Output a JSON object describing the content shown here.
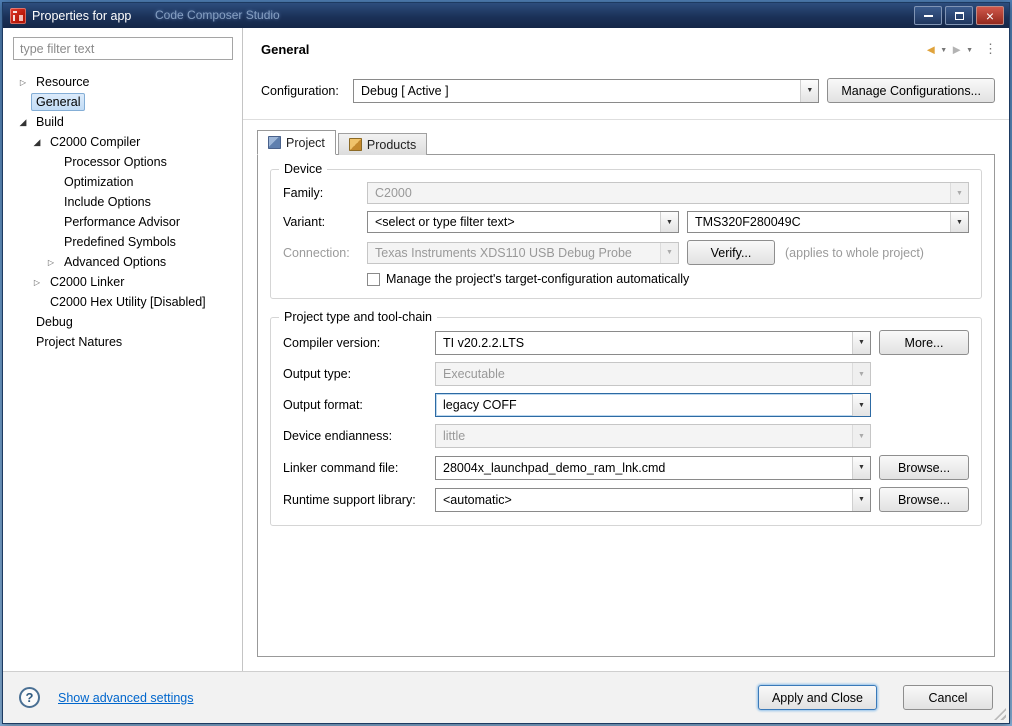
{
  "icons": {
    "collapsed": "▷",
    "expanded": "◢",
    "combo_arrow": "▼",
    "back": "◄",
    "forward": "►",
    "caret": "▼",
    "overflow": "⋮",
    "help": "?",
    "close": "×"
  },
  "desktop": {
    "background_window_title": "Code Composer Studio"
  },
  "window": {
    "title": "Properties for app"
  },
  "sidebar": {
    "filter_placeholder": "type filter text",
    "tree": [
      {
        "label": "Resource"
      },
      {
        "label": "General"
      },
      {
        "label": "Build"
      },
      {
        "label": "C2000 Compiler"
      },
      {
        "label": "Processor Options"
      },
      {
        "label": "Optimization"
      },
      {
        "label": "Include Options"
      },
      {
        "label": "Performance Advisor"
      },
      {
        "label": "Predefined Symbols"
      },
      {
        "label": "Advanced Options"
      },
      {
        "label": "C2000 Linker"
      },
      {
        "label": "C2000 Hex Utility  [Disabled]"
      },
      {
        "label": "Debug"
      },
      {
        "label": "Project Natures"
      }
    ]
  },
  "header": {
    "title": "General"
  },
  "configuration": {
    "label": "Configuration:",
    "value": "Debug  [ Active ]",
    "manage_button": "Manage Configurations..."
  },
  "tabs": {
    "project": "Project",
    "products": "Products"
  },
  "device": {
    "legend": "Device",
    "family": {
      "label": "Family:",
      "value": "C2000"
    },
    "variant": {
      "label": "Variant:",
      "filter_value": "<select or type filter text>",
      "value": "TMS320F280049C"
    },
    "connection": {
      "label": "Connection:",
      "value": "Texas Instruments XDS110 USB Debug Probe",
      "verify_button": "Verify...",
      "note": "(applies to whole project)"
    },
    "manage_target": {
      "label": "Manage the project's target-configuration automatically"
    }
  },
  "toolchain": {
    "legend": "Project type and tool-chain",
    "compiler_version": {
      "label": "Compiler version:",
      "value": "TI v20.2.2.LTS",
      "button": "More..."
    },
    "output_type": {
      "label": "Output type:",
      "value": "Executable"
    },
    "output_format": {
      "label": "Output format:",
      "value": "legacy COFF"
    },
    "device_endianness": {
      "label": "Device endianness:",
      "value": "little"
    },
    "linker_command_file": {
      "label": "Linker command file:",
      "value": "28004x_launchpad_demo_ram_lnk.cmd",
      "button": "Browse..."
    },
    "runtime_support_library": {
      "label": "Runtime support library:",
      "value": "<automatic>",
      "button": "Browse..."
    }
  },
  "footer": {
    "advanced_link": "Show advanced settings",
    "apply_button": "Apply and Close",
    "cancel_button": "Cancel"
  }
}
